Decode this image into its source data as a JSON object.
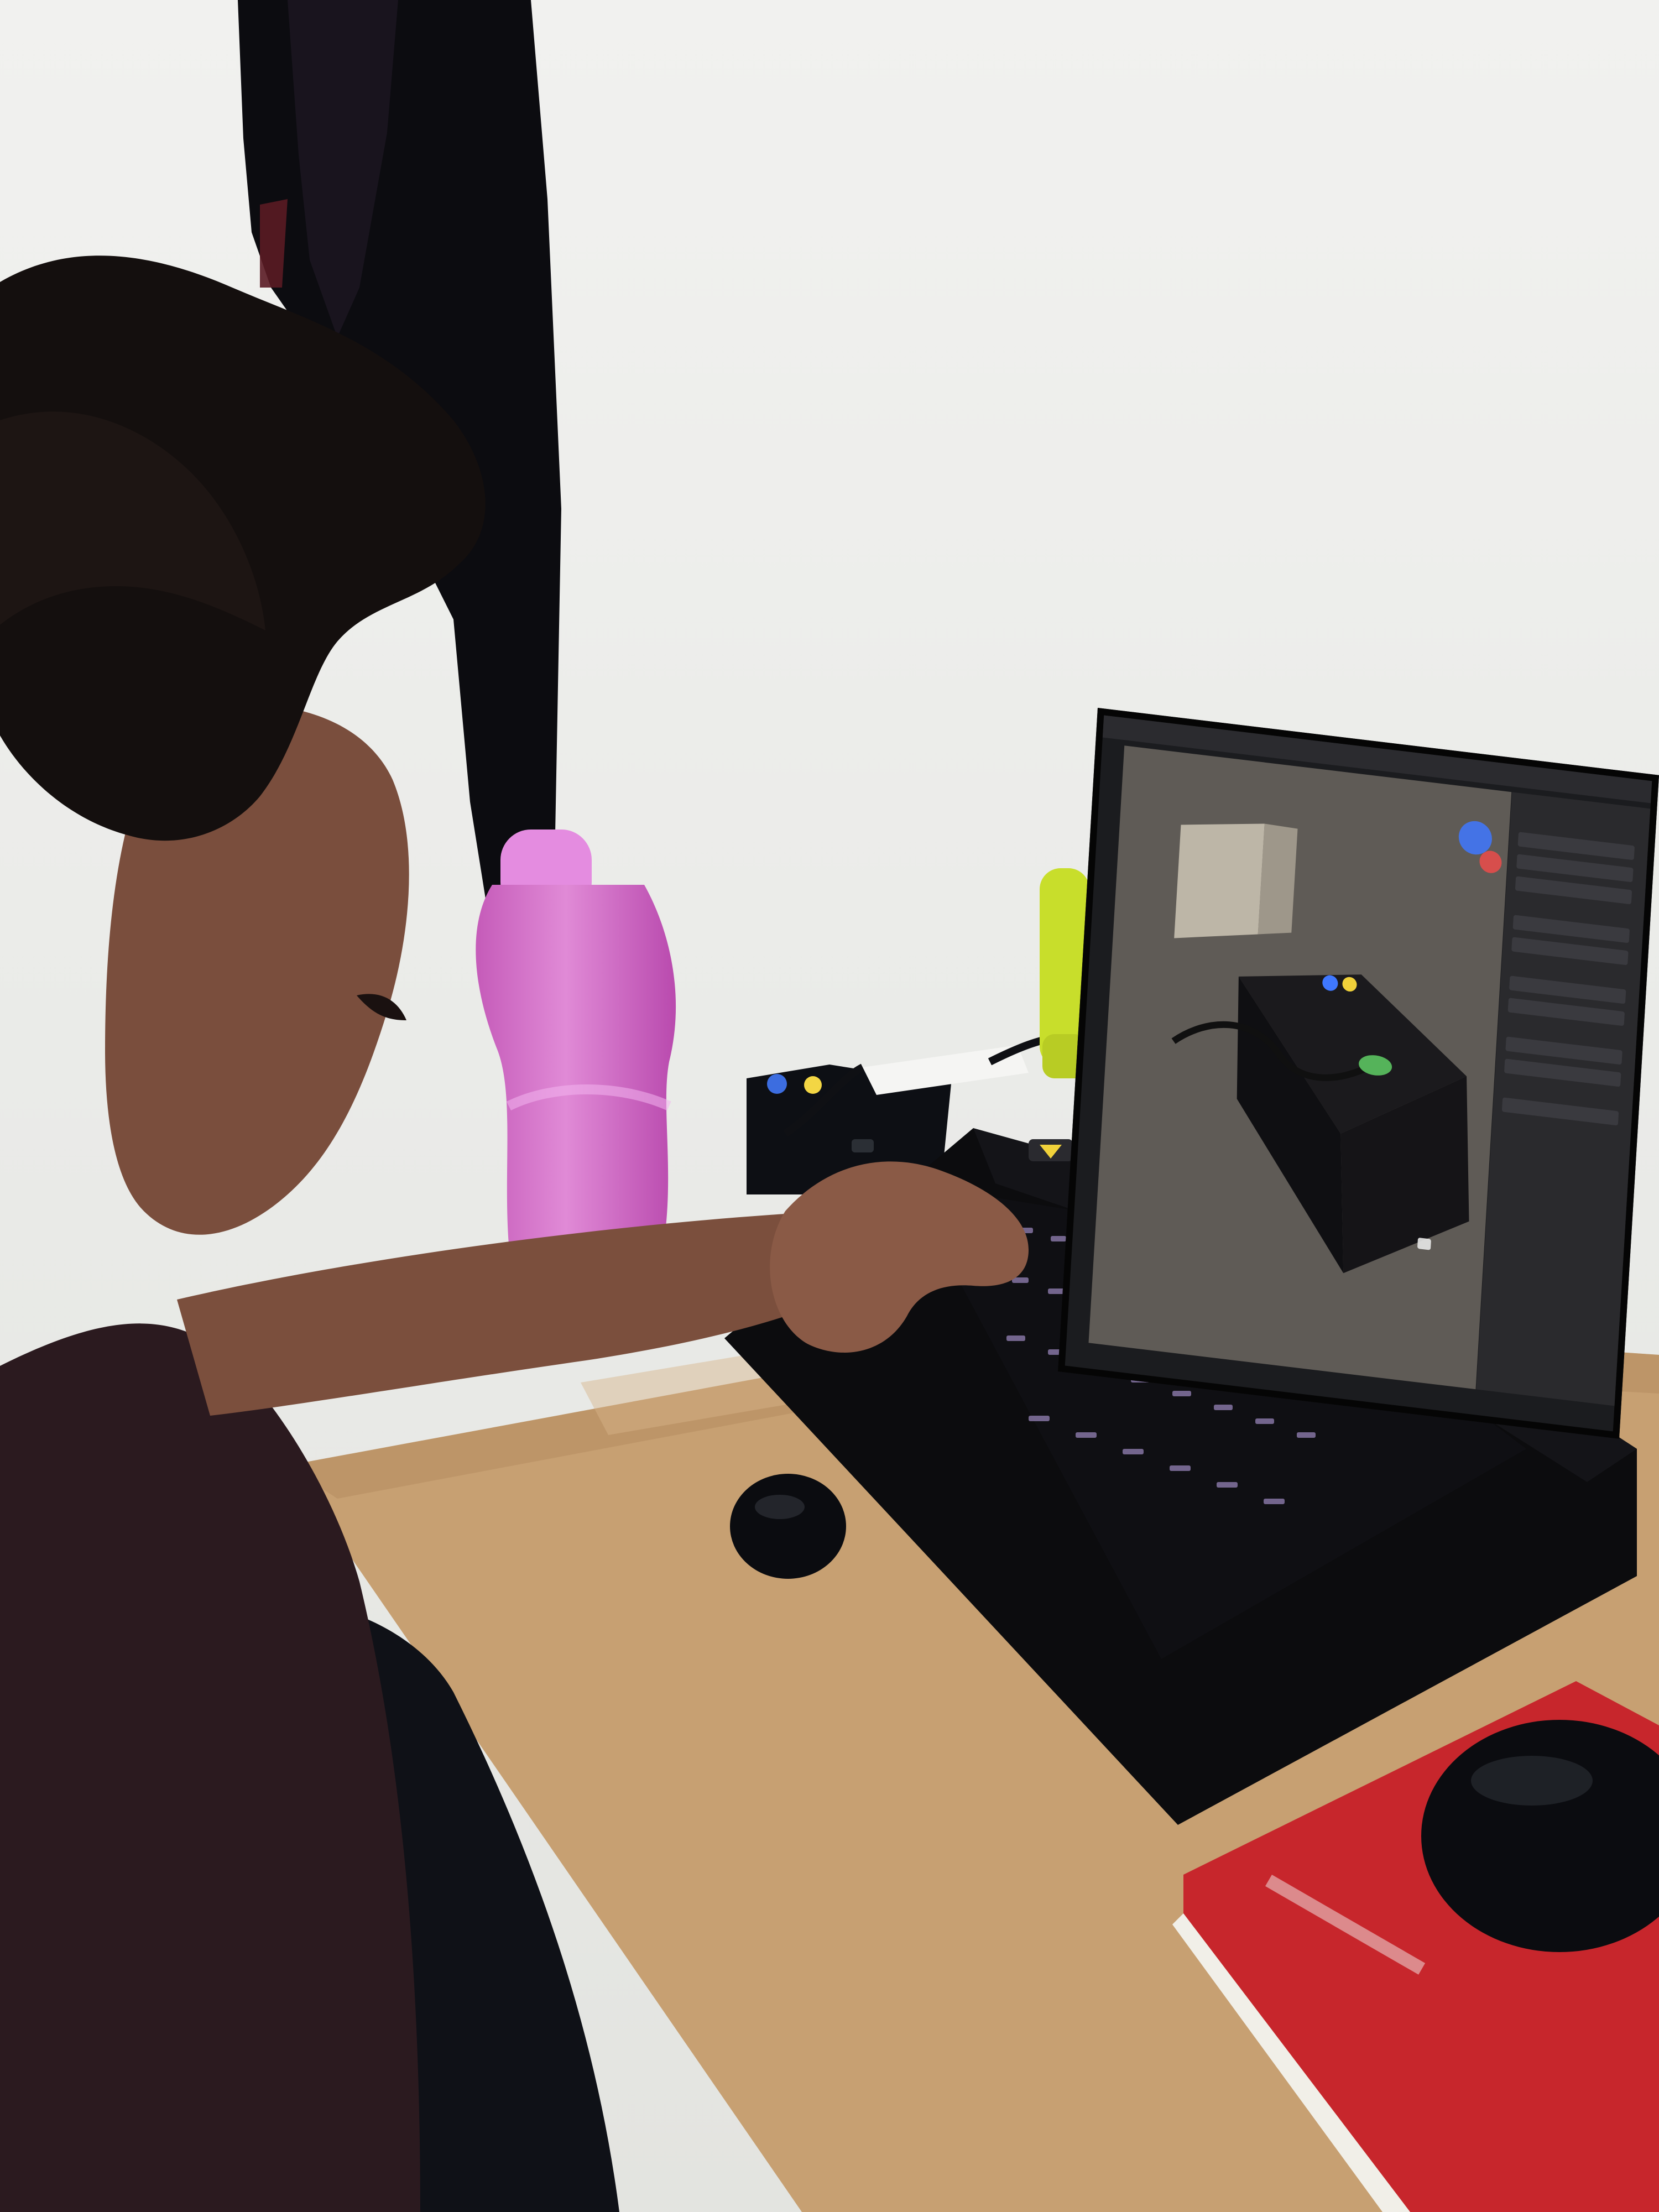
{
  "scene": {
    "description_colors": {
      "wall": "#ecedeb",
      "desk": "#c9a67a",
      "laptop": "#0b0b0d",
      "bottle": "#d275c6",
      "book": "#c7262c",
      "shirt": "#2b1a1f",
      "hair": "#140f0e"
    }
  },
  "laptop_screen": {
    "app_ui_colors": {
      "topbar": "#2b2b2f",
      "viewport": "#5f5b56",
      "properties": "#2a2a2d",
      "object": "#1b1a1d",
      "accent_blue": "#3f78ff",
      "accent_yellow": "#f0d13a",
      "accent_green": "#55b35a"
    }
  },
  "icons": {
    "mouse_small": "mouse-icon",
    "mouse_large": "mouse-icon"
  }
}
